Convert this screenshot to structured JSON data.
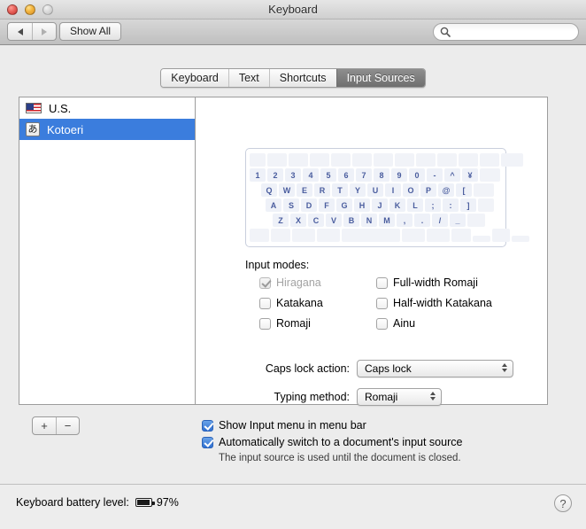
{
  "window": {
    "title": "Keyboard",
    "traffic_lights": [
      "close-button",
      "minimize-button",
      "zoom-button"
    ]
  },
  "toolbar": {
    "back_label": "back",
    "forward_label": "forward",
    "show_all_label": "Show All",
    "search": {
      "value": "",
      "placeholder": ""
    }
  },
  "tabs": [
    {
      "label": "Keyboard",
      "active": false
    },
    {
      "label": "Text",
      "active": false
    },
    {
      "label": "Shortcuts",
      "active": false
    },
    {
      "label": "Input Sources",
      "active": true
    }
  ],
  "sources": [
    {
      "label": "U.S.",
      "icon": "us-flag-icon",
      "selected": false
    },
    {
      "label": "Kotoeri",
      "icon": "kana-icon",
      "glyph": "あ",
      "selected": true
    }
  ],
  "list_buttons": {
    "add": "+",
    "remove": "−"
  },
  "keyboard_preview": {
    "rows": [
      {
        "lead": 0,
        "keys": [
          "",
          "",
          "",
          "",
          "",
          "",
          "",
          "",
          "",
          "",
          "",
          "",
          "",
          ""
        ],
        "blank": true
      },
      {
        "lead": 0,
        "keys": [
          "1",
          "2",
          "3",
          "4",
          "5",
          "6",
          "7",
          "8",
          "9",
          "0",
          "-",
          "^",
          "¥"
        ]
      },
      {
        "lead": 1,
        "keys": [
          "Q",
          "W",
          "E",
          "R",
          "T",
          "Y",
          "U",
          "I",
          "O",
          "P",
          "@",
          "["
        ]
      },
      {
        "lead": 1,
        "keys": [
          "A",
          "S",
          "D",
          "F",
          "G",
          "H",
          "J",
          "K",
          "L",
          ";",
          ":",
          "]"
        ]
      },
      {
        "lead": 2,
        "keys": [
          "Z",
          "X",
          "C",
          "V",
          "B",
          "N",
          "M",
          ",",
          ".",
          "/",
          "_"
        ]
      },
      {
        "lead": 0,
        "keys": [
          "",
          "",
          "",
          "",
          "",
          "",
          "",
          "",
          ""
        ],
        "blank": true
      }
    ]
  },
  "input_modes": {
    "title": "Input modes:",
    "items": [
      {
        "label": "Hiragana",
        "checked": true,
        "disabled": true
      },
      {
        "label": "Full-width Romaji",
        "checked": false,
        "disabled": false
      },
      {
        "label": "Katakana",
        "checked": false,
        "disabled": false
      },
      {
        "label": "Half-width Katakana",
        "checked": false,
        "disabled": false
      },
      {
        "label": "Romaji",
        "checked": false,
        "disabled": false
      },
      {
        "label": "Ainu",
        "checked": false,
        "disabled": false
      }
    ]
  },
  "popups": {
    "caps_lock": {
      "label": "Caps lock action:",
      "value": "Caps lock"
    },
    "typing_method": {
      "label": "Typing method:",
      "value": "Romaji"
    }
  },
  "bottom_options": {
    "show_input_menu": {
      "label": "Show Input menu in menu bar",
      "checked": true
    },
    "auto_switch": {
      "label": "Automatically switch to a document's input source",
      "checked": true
    },
    "note": "The input source is used until the document is closed."
  },
  "status": {
    "battery_label": "Keyboard battery level:",
    "battery_percent": "97%",
    "help_label": "?"
  },
  "colors": {
    "selection_blue": "#3b7ddd",
    "checkbox_blue": "#2f6fd0",
    "key_text": "#4a5d9e",
    "active_tab_gray": "#6f6f6f"
  }
}
